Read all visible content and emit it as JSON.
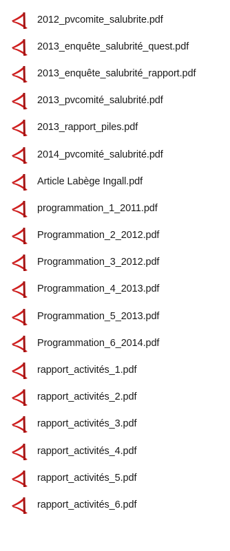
{
  "files": [
    {
      "name": "2012_pvcomite_salubrite.pdf",
      "icon": "pdf-file-icon"
    },
    {
      "name": "2013_enquête_salubrité_quest.pdf",
      "icon": "pdf-file-icon"
    },
    {
      "name": "2013_enquête_salubrité_rapport.pdf",
      "icon": "pdf-file-icon"
    },
    {
      "name": "2013_pvcomité_salubrité.pdf",
      "icon": "pdf-file-icon"
    },
    {
      "name": "2013_rapport_piles.pdf",
      "icon": "pdf-file-icon"
    },
    {
      "name": "2014_pvcomité_salubrité.pdf",
      "icon": "pdf-file-icon"
    },
    {
      "name": "Article Labège Ingall.pdf",
      "icon": "pdf-file-icon"
    },
    {
      "name": "programmation_1_2011.pdf",
      "icon": "pdf-file-icon"
    },
    {
      "name": "Programmation_2_2012.pdf",
      "icon": "pdf-file-icon"
    },
    {
      "name": "Programmation_3_2012.pdf",
      "icon": "pdf-file-icon"
    },
    {
      "name": "Programmation_4_2013.pdf",
      "icon": "pdf-file-icon"
    },
    {
      "name": "Programmation_5_2013.pdf",
      "icon": "pdf-file-icon"
    },
    {
      "name": "Programmation_6_2014.pdf",
      "icon": "pdf-file-icon"
    },
    {
      "name": "rapport_activités_1.pdf",
      "icon": "pdf-file-icon"
    },
    {
      "name": "rapport_activités_2.pdf",
      "icon": "pdf-file-icon"
    },
    {
      "name": "rapport_activités_3.pdf",
      "icon": "pdf-file-icon"
    },
    {
      "name": "rapport_activités_4.pdf",
      "icon": "pdf-file-icon"
    },
    {
      "name": "rapport_activités_5.pdf",
      "icon": "pdf-file-icon"
    },
    {
      "name": "rapport_activités_6.pdf",
      "icon": "pdf-file-icon"
    }
  ],
  "colors": {
    "icon_red": "#d01f1f",
    "icon_dark_red": "#a31515",
    "text": "#1a1a1a"
  }
}
